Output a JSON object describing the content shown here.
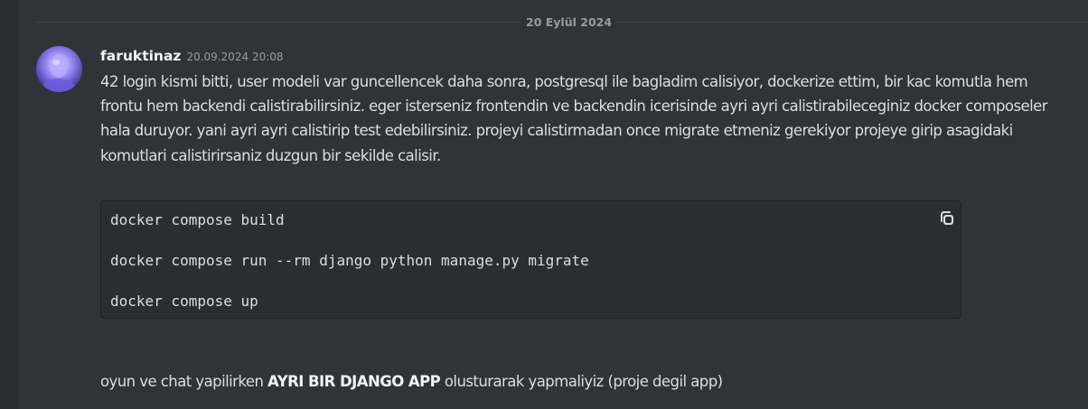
{
  "divider": {
    "date_label": "20 Eylül 2024"
  },
  "message": {
    "username": "faruktinaz",
    "timestamp": "20.09.2024 20:08",
    "avatar_icon": "avatar-icon",
    "text": "42 login kismi bitti, user modeli var guncellencek daha sonra, postgresql ile bagladim calisiyor, dockerize ettim, bir kac komutla hem frontu hem backendi calistirabilirsiniz. eger isterseniz frontendin ve backendin icerisinde ayri ayri calistirabileceginiz docker composeler hala duruyor. yani ayri ayri calistirip test edebilirsiniz. projeyi calistirmadan once migrate etmeniz gerekiyor projeye girip asagidaki komutlari calistirirsaniz duzgun bir sekilde calisir.",
    "code_lines": [
      "docker compose build",
      "docker compose run --rm django python manage.py migrate",
      "docker compose up"
    ],
    "copy_icon": "copy-icon"
  },
  "message2": {
    "text_before": "oyun ve chat yapilirken ",
    "text_bold": "AYRI BIR DJANGO APP",
    "text_after": " olusturarak yapmaliyiz (proje degil app)"
  },
  "colors": {
    "background": "#313338",
    "code_background": "#2b2d31",
    "text": "#dbdee1",
    "muted": "#949ba4",
    "username": "#f2f3f5"
  }
}
